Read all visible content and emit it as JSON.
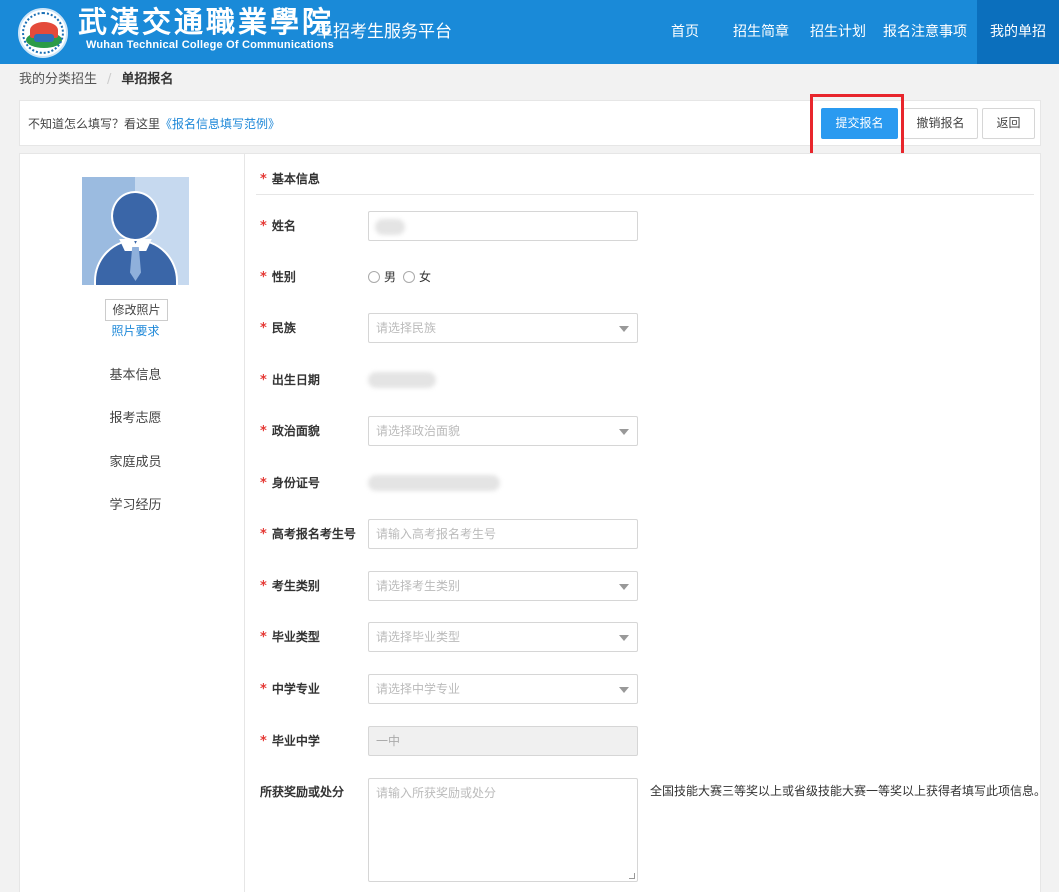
{
  "header": {
    "logo_cn": "武漢交通職業學院",
    "logo_en": "Wuhan Technical College Of Communications",
    "platform_title": "单招考生服务平台",
    "nav": [
      {
        "label": "首页",
        "active": false
      },
      {
        "label": "招生简章",
        "active": false
      },
      {
        "label": "招生计划",
        "active": false
      },
      {
        "label": "报名注意事项",
        "active": false
      },
      {
        "label": "我的单招",
        "active": true
      }
    ]
  },
  "breadcrumb": {
    "parent": "我的分类招生",
    "separator": "/",
    "current": "单招报名"
  },
  "toolbar": {
    "help_text": "不知道怎么填写？看这里",
    "help_link": "《报名信息填写范例》",
    "submit_label": "提交报名",
    "cancel_label": "撤销报名",
    "back_label": "返回"
  },
  "sidebar": {
    "change_photo": "修改照片",
    "photo_requirements": "照片要求",
    "items": [
      "基本信息",
      "报考志愿",
      "家庭成员",
      "学习经历"
    ]
  },
  "form": {
    "section_title": "基本信息",
    "required_mark": "*",
    "name": {
      "label": "姓名",
      "value": ""
    },
    "gender": {
      "label": "性别",
      "options": [
        "男",
        "女"
      ]
    },
    "ethnicity": {
      "label": "民族",
      "placeholder": "请选择民族"
    },
    "birthdate": {
      "label": "出生日期"
    },
    "political": {
      "label": "政治面貌",
      "placeholder": "请选择政治面貌"
    },
    "id_number": {
      "label": "身份证号"
    },
    "exam_number": {
      "label": "高考报名考生号",
      "placeholder": "请输入高考报名考生号"
    },
    "candidate_type": {
      "label": "考生类别",
      "placeholder": "请选择考生类别"
    },
    "graduation_type": {
      "label": "毕业类型",
      "placeholder": "请选择毕业类型"
    },
    "high_school_major": {
      "label": "中学专业",
      "placeholder": "请选择中学专业"
    },
    "graduated_school": {
      "label": "毕业中学",
      "value": "一中"
    },
    "awards": {
      "label": "所获奖励或处分",
      "placeholder": "请输入所获奖励或处分",
      "hint": "全国技能大赛三等奖以上或省级技能大赛一等奖以上获得者填写此项信息。"
    }
  },
  "colors": {
    "header_bg": "#1a8ad8",
    "nav_active_bg": "#0b6fbd",
    "primary_button": "#2a9af0",
    "required_star": "#e53935",
    "link": "#1e88d8",
    "annotation": "#e8262c"
  }
}
